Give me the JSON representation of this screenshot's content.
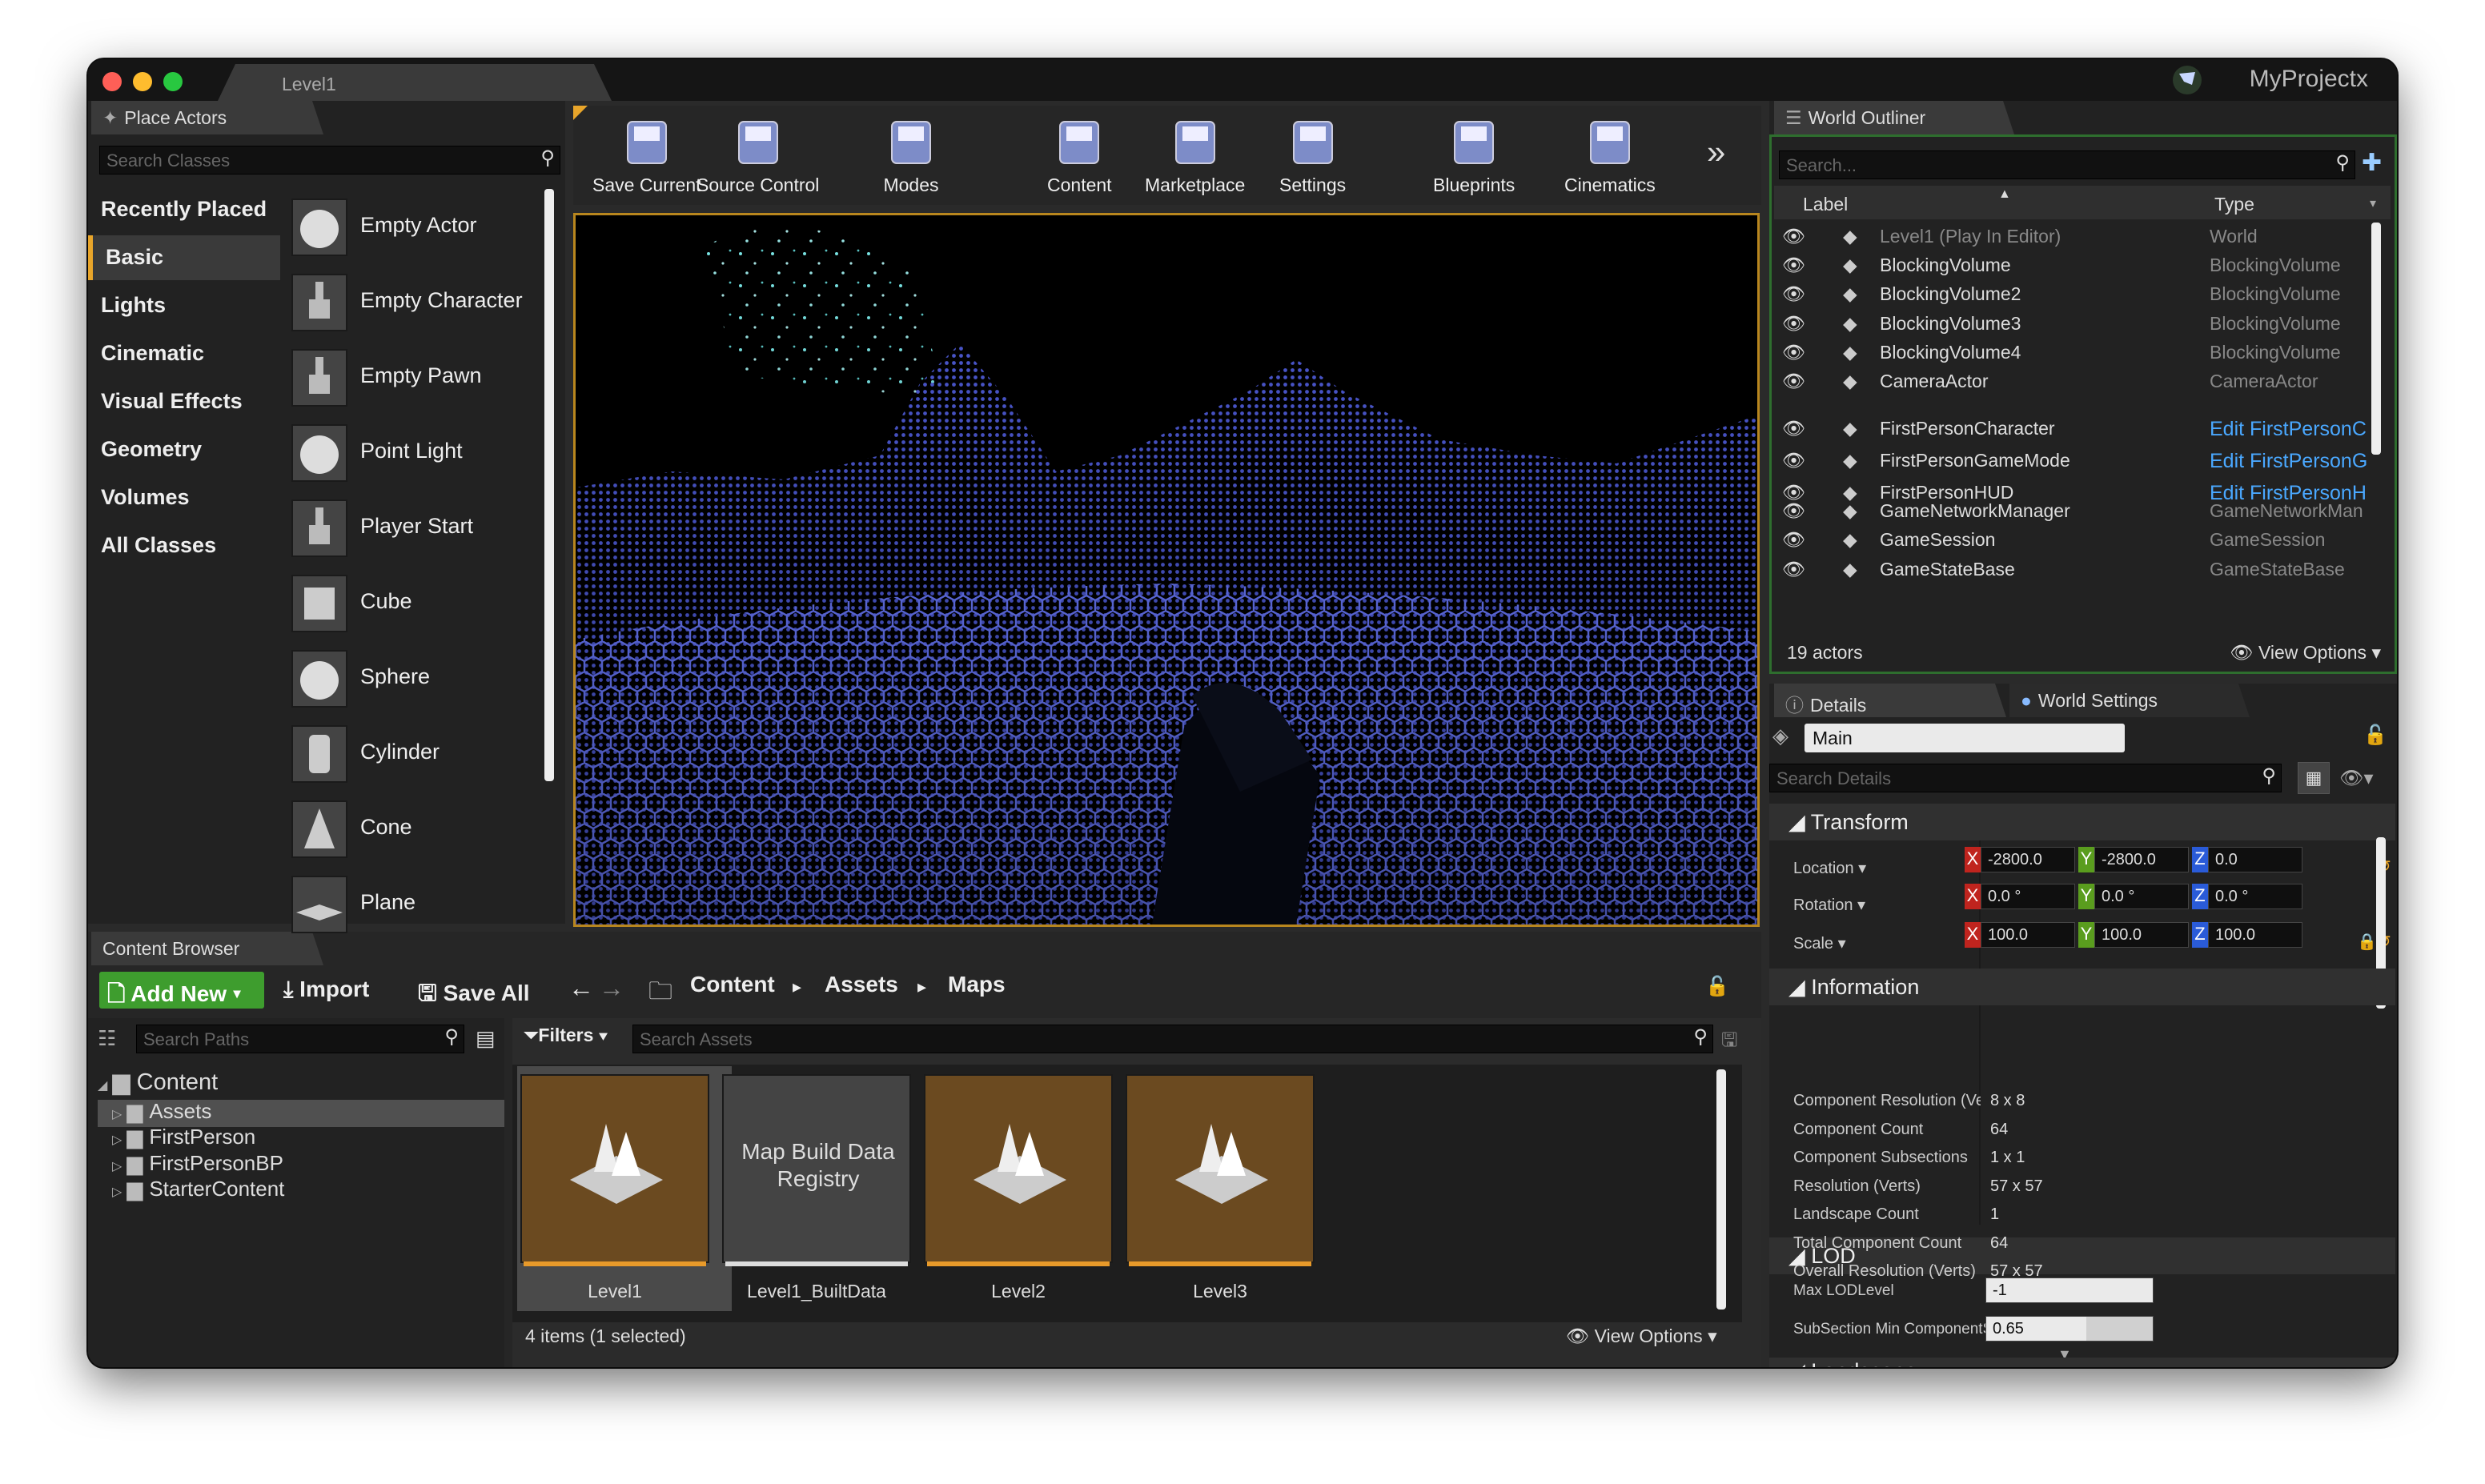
{
  "window": {
    "tab_title": "Level1",
    "project_name": "MyProjectx"
  },
  "place_actors": {
    "tab": "Place Actors",
    "search_placeholder": "Search Classes",
    "categories": [
      "Recently Placed",
      "Basic",
      "Lights",
      "Cinematic",
      "Visual Effects",
      "Geometry",
      "Volumes",
      "All Classes"
    ],
    "selected_category": "Basic",
    "items": [
      "Empty Actor",
      "Empty Character",
      "Empty Pawn",
      "Point Light",
      "Player Start",
      "Cube",
      "Sphere",
      "Cylinder",
      "Cone",
      "Plane"
    ]
  },
  "toolbar": {
    "buttons": [
      "Save Current",
      "Source Control",
      "Modes",
      "Content",
      "Marketplace",
      "Settings",
      "Blueprints",
      "Cinematics"
    ]
  },
  "world_outliner": {
    "tab": "World Outliner",
    "search_placeholder": "Search...",
    "col_label": "Label",
    "col_type": "Type",
    "rows": [
      {
        "label": "Level1 (Play In Editor)",
        "type": "World",
        "icon": "world-icon",
        "link": false
      },
      {
        "label": "BlockingVolume",
        "type": "BlockingVolume",
        "icon": "volume-icon",
        "link": false
      },
      {
        "label": "BlockingVolume2",
        "type": "BlockingVolume",
        "icon": "volume-icon",
        "link": false
      },
      {
        "label": "BlockingVolume3",
        "type": "BlockingVolume",
        "icon": "volume-icon",
        "link": false
      },
      {
        "label": "BlockingVolume4",
        "type": "BlockingVolume",
        "icon": "volume-icon",
        "link": false
      },
      {
        "label": "CameraActor",
        "type": "CameraActor",
        "icon": "camera-icon",
        "link": false
      },
      {
        "label": "FirstPersonCharacter",
        "type": "Edit FirstPersonC",
        "icon": "character-icon",
        "link": true
      },
      {
        "label": "FirstPersonGameMode",
        "type": "Edit FirstPersonG",
        "icon": "gamemode-icon",
        "link": true
      },
      {
        "label": "FirstPersonHUD",
        "type": "Edit FirstPersonH",
        "icon": "hud-icon",
        "link": true
      },
      {
        "label": "GameNetworkManager",
        "type": "GameNetworkMan",
        "icon": "sphere-icon",
        "link": false
      },
      {
        "label": "GameSession",
        "type": "GameSession",
        "icon": "sphere-icon",
        "link": false
      },
      {
        "label": "GameStateBase",
        "type": "GameStateBase",
        "icon": "state-icon",
        "link": false
      }
    ],
    "actor_count": "19 actors",
    "view_options": "View Options"
  },
  "details": {
    "tab_details": "Details",
    "tab_world": "World Settings",
    "name_value": "Main",
    "search_placeholder": "Search Details",
    "transform_header": "Transform",
    "location_label": "Location",
    "rotation_label": "Rotation",
    "scale_label": "Scale",
    "location": [
      "-2800.0",
      "-2800.0",
      "0.0"
    ],
    "rotation": [
      "0.0 °",
      "0.0 °",
      "0.0 °"
    ],
    "scale": [
      "100.0",
      "100.0",
      "100.0"
    ],
    "info_header": "Information",
    "info_rows": [
      {
        "k": "Component Resolution (Verts)",
        "v": "8 x 8"
      },
      {
        "k": "Component Count",
        "v": "64"
      },
      {
        "k": "Component Subsections",
        "v": "1 x 1"
      },
      {
        "k": "Resolution (Verts)",
        "v": "57 x 57"
      },
      {
        "k": "Landscape Count",
        "v": "1"
      },
      {
        "k": "Total Component Count",
        "v": "64"
      },
      {
        "k": "Overall Resolution (Verts)",
        "v": "57 x 57"
      }
    ],
    "lod_header": "LOD",
    "max_lod_label": "Max LODLevel",
    "max_lod_value": "-1",
    "subsection_label": "SubSection Min ComponentScreenSize",
    "subsection_value": "0.65",
    "landscape_header": "Landscape"
  },
  "content_browser": {
    "tab": "Content Browser",
    "add_new": "Add New",
    "import": "Import",
    "save_all": "Save All",
    "breadcrumb": [
      "Content",
      "Assets",
      "Maps"
    ],
    "search_paths_placeholder": "Search Paths",
    "filters": "Filters",
    "search_assets_placeholder": "Search Assets",
    "tree": [
      {
        "name": "Content",
        "level": 0
      },
      {
        "name": "Assets",
        "level": 1
      },
      {
        "name": "FirstPerson",
        "level": 1
      },
      {
        "name": "FirstPersonBP",
        "level": 1
      },
      {
        "name": "StarterContent",
        "level": 1
      }
    ],
    "assets": [
      {
        "name": "Level1",
        "thumb_text": ""
      },
      {
        "name": "Level1_BuiltData",
        "thumb_text": "Map Build Data Registry"
      },
      {
        "name": "Level2",
        "thumb_text": ""
      },
      {
        "name": "Level3",
        "thumb_text": ""
      }
    ],
    "status": "4 items (1 selected)",
    "view_options": "View Options"
  },
  "colors": {
    "accent": "#e8a52a",
    "link": "#4aa8ff",
    "add_green": "#3e9d2e",
    "outliner_border": "#2e6e2e",
    "hex_grid": "#5a6ae8"
  }
}
